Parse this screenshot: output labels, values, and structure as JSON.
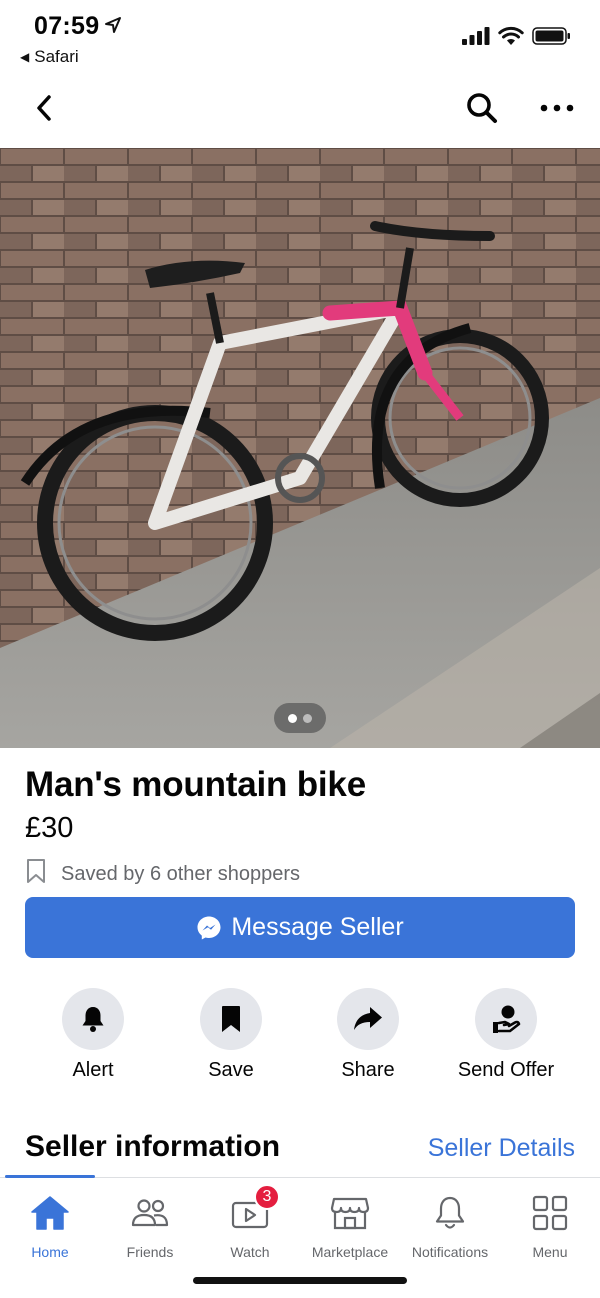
{
  "status_bar": {
    "time": "07:59",
    "back_app": "Safari",
    "icons": [
      "location-arrow-icon",
      "cellular-signal-icon",
      "wifi-icon",
      "battery-icon"
    ]
  },
  "nav": {
    "icons": [
      "back-chevron-icon",
      "search-icon",
      "more-dots-icon"
    ]
  },
  "photo": {
    "image_count": 2,
    "current_index": 1
  },
  "listing": {
    "title": "Man's mountain bike",
    "price": "£30",
    "saved_text": "Saved by 6 other shoppers"
  },
  "message_button": {
    "label": "Message Seller"
  },
  "actions": [
    {
      "label": "Alert",
      "icon": "bell-icon"
    },
    {
      "label": "Save",
      "icon": "bookmark-icon"
    },
    {
      "label": "Share",
      "icon": "share-arrow-icon"
    },
    {
      "label": "Send Offer",
      "icon": "offer-hand-icon"
    }
  ],
  "seller": {
    "title": "Seller information",
    "link": "Seller Details"
  },
  "tabbar": {
    "tabs": [
      {
        "label": "Home",
        "icon": "home-icon",
        "active": true
      },
      {
        "label": "Friends",
        "icon": "friends-icon"
      },
      {
        "label": "Watch",
        "icon": "watch-icon",
        "badge": "3"
      },
      {
        "label": "Marketplace",
        "icon": "marketplace-icon"
      },
      {
        "label": "Notifications",
        "icon": "bell-outline-icon"
      },
      {
        "label": "Menu",
        "icon": "menu-grid-icon"
      }
    ]
  },
  "colors": {
    "accent": "#3a74d8",
    "badge": "#e41e3f",
    "secondary_text": "#65676b",
    "chip_bg": "#e4e6eb"
  }
}
